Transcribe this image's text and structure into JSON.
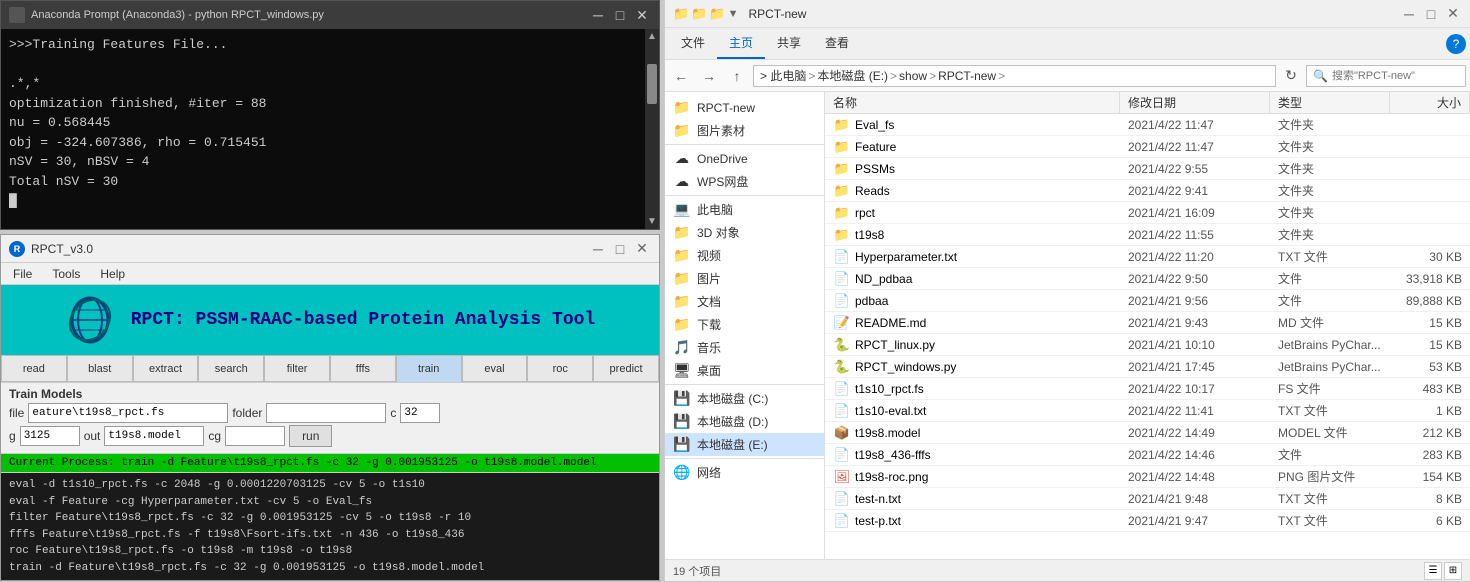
{
  "terminal": {
    "title": "Anaconda Prompt (Anaconda3) - python  RPCT_windows.py",
    "lines": [
      ">>>Training Features File...",
      "",
      ".*,*",
      "optimization finished, #iter = 88",
      "nu = 0.568445",
      "obj = -324.607386, rho = 0.715451",
      "nSV = 30, nBSV = 4",
      "Total nSV = 30",
      ""
    ]
  },
  "rpct_app": {
    "title": "RPCT_v3.0",
    "header_title": "RPCT: PSSM-RAAC-based Protein Analysis Tool",
    "menu": [
      "File",
      "Tools",
      "Help"
    ],
    "toolbar_buttons": [
      "read",
      "blast",
      "extract",
      "search",
      "filter",
      "fffs",
      "train",
      "eval",
      "roc",
      "predict"
    ],
    "active_tool": "train",
    "form_title": "Train Models",
    "file_label": "file",
    "file_value": "eature\\t19s8_rpct.fs",
    "folder_label": "folder",
    "folder_value": "",
    "c_label": "c",
    "c_value": "32",
    "g_label": "g",
    "g_value": "3125",
    "out_label": "out",
    "out_value": "t19s8.model",
    "cg_label": "cg",
    "cg_value": "",
    "run_label": "run",
    "status_label": "Current Process:",
    "status_tool": "train",
    "status_cmd": "-d Feature\\t19s8_rpct.fs -c 32 -g 0.001953125 -o t19s8.model.model",
    "log_lines": [
      "eval    -d t1s10_rpct.fs -c 2048 -g 0.0001220703125 -cv 5 -o t1s10",
      "eval    -f Feature -cg Hyperparameter.txt -cv 5 -o Eval_fs",
      "filter  Feature\\t19s8_rpct.fs -c 32 -g 0.001953125 -cv 5 -o t19s8 -r 10",
      "fffs    Feature\\t19s8_rpct.fs -f t19s8\\Fsort-ifs.txt -n 436 -o t19s8_436",
      "roc     Feature\\t19s8_rpct.fs -o t19s8 -m t19s8 -o t19s8",
      "train   -d Feature\\t19s8_rpct.fs -c 32 -g 0.001953125 -o t19s8.model.model"
    ]
  },
  "file_explorer": {
    "title": "RPCT-new",
    "ribbon_tabs": [
      "文件",
      "主页",
      "共享",
      "查看"
    ],
    "active_tab": "主页",
    "breadcrumb": [
      "此电脑",
      "本地磁盘 (E:)",
      "show",
      "RPCT-new"
    ],
    "search_placeholder": "搜索\"RPCT-new\"",
    "sidebar_items": [
      {
        "label": "RPCT-new",
        "icon": "folder",
        "type": "folder"
      },
      {
        "label": "图片素材",
        "icon": "folder",
        "type": "folder"
      },
      {
        "label": "OneDrive",
        "icon": "cloud",
        "type": "cloud"
      },
      {
        "label": "WPS网盘",
        "icon": "cloud",
        "type": "cloud"
      },
      {
        "label": "此电脑",
        "icon": "computer",
        "type": "computer"
      },
      {
        "label": "3D 对象",
        "icon": "cube",
        "type": "folder"
      },
      {
        "label": "视频",
        "icon": "video",
        "type": "folder"
      },
      {
        "label": "图片",
        "icon": "image",
        "type": "folder"
      },
      {
        "label": "文档",
        "icon": "doc",
        "type": "folder"
      },
      {
        "label": "下载",
        "icon": "download",
        "type": "folder"
      },
      {
        "label": "音乐",
        "icon": "music",
        "type": "folder"
      },
      {
        "label": "桌面",
        "icon": "desktop",
        "type": "folder"
      },
      {
        "label": "本地磁盘 (C:)",
        "icon": "drive",
        "type": "drive"
      },
      {
        "label": "本地磁盘 (D:)",
        "icon": "drive",
        "type": "drive"
      },
      {
        "label": "本地磁盘 (E:)",
        "icon": "drive",
        "type": "drive",
        "selected": true
      },
      {
        "label": "网络",
        "icon": "network",
        "type": "network"
      }
    ],
    "columns": [
      "名称",
      "修改日期",
      "类型",
      "大小"
    ],
    "files": [
      {
        "name": "Eval_fs",
        "date": "2021/4/22 11:47",
        "type": "文件夹",
        "size": "",
        "icon": "folder"
      },
      {
        "name": "Feature",
        "date": "2021/4/22 11:47",
        "type": "文件夹",
        "size": "",
        "icon": "folder"
      },
      {
        "name": "PSSMs",
        "date": "2021/4/22 9:55",
        "type": "文件夹",
        "size": "",
        "icon": "folder"
      },
      {
        "name": "Reads",
        "date": "2021/4/22 9:41",
        "type": "文件夹",
        "size": "",
        "icon": "folder"
      },
      {
        "name": "rpct",
        "date": "2021/4/21 16:09",
        "type": "文件夹",
        "size": "",
        "icon": "folder"
      },
      {
        "name": "t19s8",
        "date": "2021/4/22 11:55",
        "type": "文件夹",
        "size": "",
        "icon": "folder"
      },
      {
        "name": "Hyperparameter.txt",
        "date": "2021/4/22 11:20",
        "type": "TXT 文件",
        "size": "30 KB",
        "icon": "txt"
      },
      {
        "name": "ND_pdbaa",
        "date": "2021/4/22 9:50",
        "type": "文件",
        "size": "33,918 KB",
        "icon": "file"
      },
      {
        "name": "pdbaa",
        "date": "2021/4/21 9:56",
        "type": "文件",
        "size": "89,888 KB",
        "icon": "file"
      },
      {
        "name": "README.md",
        "date": "2021/4/21 9:43",
        "type": "MD 文件",
        "size": "15 KB",
        "icon": "md"
      },
      {
        "name": "RPCT_linux.py",
        "date": "2021/4/21 10:10",
        "type": "JetBrains PyChar...",
        "size": "15 KB",
        "icon": "py"
      },
      {
        "name": "RPCT_windows.py",
        "date": "2021/4/21 17:45",
        "type": "JetBrains PyChar...",
        "size": "53 KB",
        "icon": "py"
      },
      {
        "name": "t1s10_rpct.fs",
        "date": "2021/4/22 10:17",
        "type": "FS 文件",
        "size": "483 KB",
        "icon": "file"
      },
      {
        "name": "t1s10-eval.txt",
        "date": "2021/4/22 11:41",
        "type": "TXT 文件",
        "size": "1 KB",
        "icon": "txt"
      },
      {
        "name": "t19s8.model",
        "date": "2021/4/22 14:49",
        "type": "MODEL 文件",
        "size": "212 KB",
        "icon": "model"
      },
      {
        "name": "t19s8_436-fffs",
        "date": "2021/4/22 14:46",
        "type": "文件",
        "size": "283 KB",
        "icon": "file"
      },
      {
        "name": "t19s8-roc.png",
        "date": "2021/4/22 14:48",
        "type": "PNG 图片文件",
        "size": "154 KB",
        "icon": "png"
      },
      {
        "name": "test-n.txt",
        "date": "2021/4/21 9:48",
        "type": "TXT 文件",
        "size": "8 KB",
        "icon": "txt"
      },
      {
        "name": "test-p.txt",
        "date": "2021/4/21 9:47",
        "type": "TXT 文件",
        "size": "6 KB",
        "icon": "txt"
      }
    ],
    "status_count": "19 个项目",
    "icon_labels": {
      "folder": "📁",
      "cloud": "☁",
      "computer": "💻",
      "cube": "⬛",
      "video": "🎬",
      "image": "🖼",
      "doc": "📄",
      "download": "⬇",
      "music": "🎵",
      "desktop": "🖥",
      "drive": "💾",
      "network": "🌐"
    }
  }
}
